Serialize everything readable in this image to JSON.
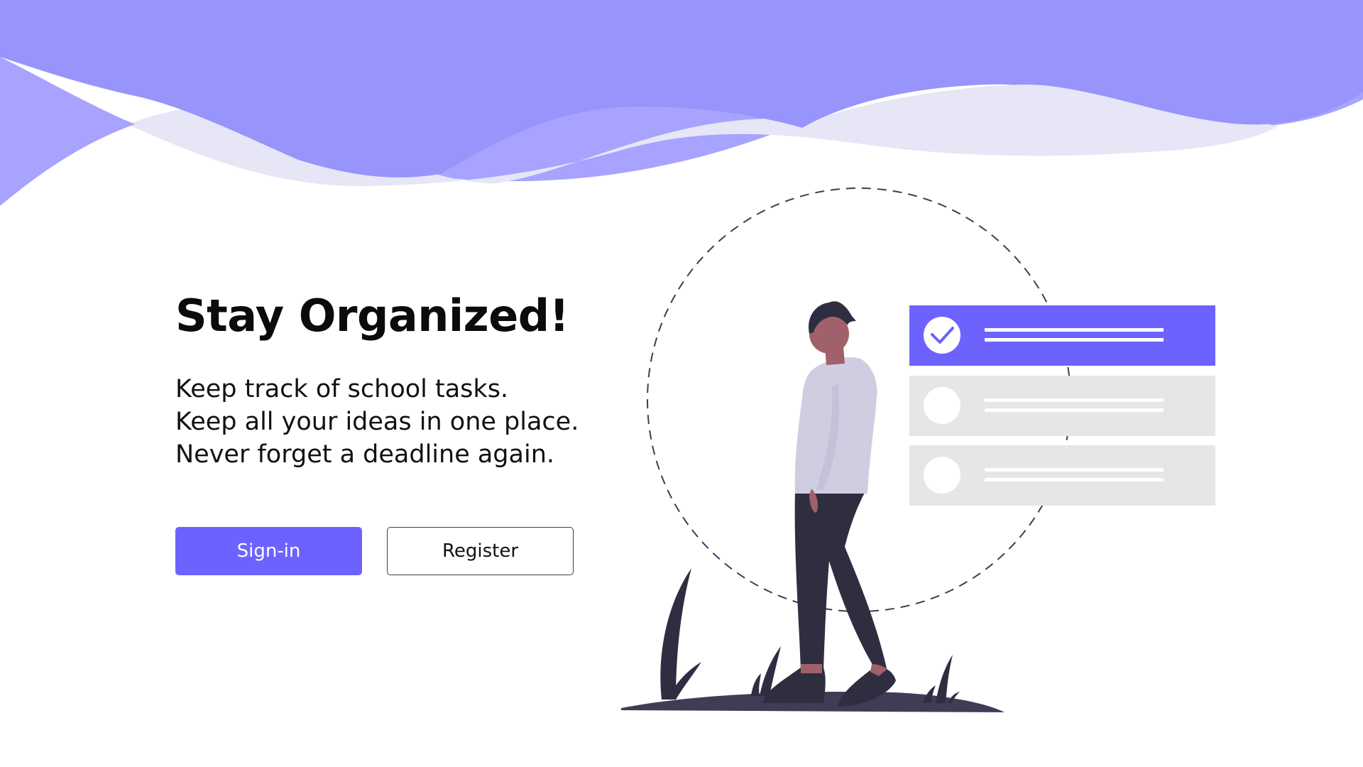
{
  "hero": {
    "title": "Stay Organized!",
    "lines": [
      "Keep track of school tasks.",
      "Keep all your ideas in one place.",
      "Never forget a deadline again."
    ]
  },
  "buttons": {
    "signin_label": "Sign-in",
    "register_label": "Register"
  },
  "colors": {
    "accent": "#6c63ff",
    "wave_dark": "#9794fc",
    "wave_mid": "#a7a3ff",
    "wave_light": "#e6e6f7",
    "card_inactive": "#e6e6e6",
    "ink": "#3f3d56"
  },
  "illustration": {
    "task_list": [
      {
        "completed": true
      },
      {
        "completed": false
      },
      {
        "completed": false
      }
    ],
    "icons": [
      "check-icon",
      "person-illustration",
      "grass-illustration"
    ]
  }
}
